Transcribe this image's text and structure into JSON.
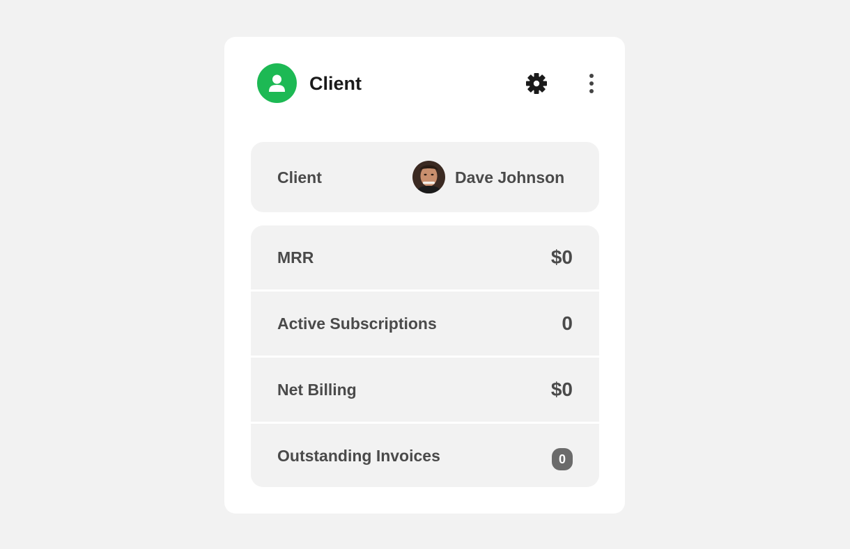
{
  "header": {
    "title": "Client",
    "icon": "user-icon",
    "accent_color": "#1db954"
  },
  "client": {
    "label": "Client",
    "name": "Dave Johnson"
  },
  "stats": [
    {
      "label": "MRR",
      "value": "$0"
    },
    {
      "label": "Active Subscriptions",
      "value": "0"
    },
    {
      "label": "Net Billing",
      "value": "$0"
    },
    {
      "label": "Outstanding Invoices",
      "value": "0"
    }
  ],
  "actions": {
    "settings_icon": "gear-icon",
    "more_icon": "more-vertical-icon"
  },
  "badge_color": "#6b6b6b"
}
